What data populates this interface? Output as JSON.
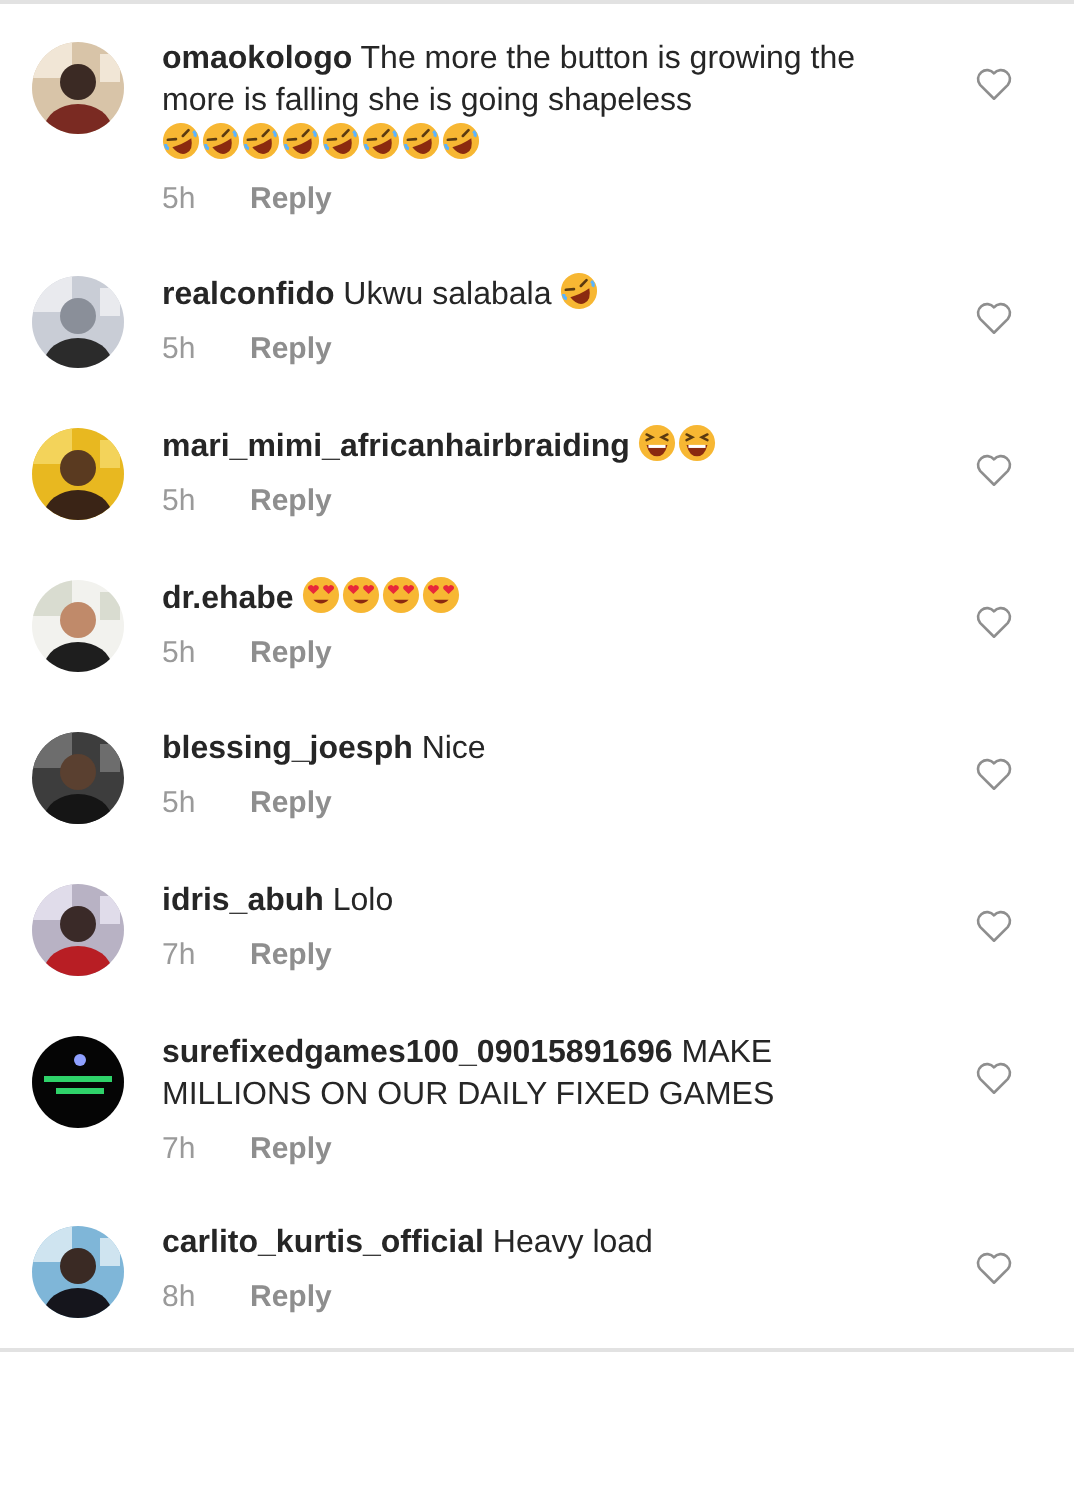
{
  "comments": [
    {
      "avatar": {
        "kind": "picture"
      },
      "username": "omaokologo",
      "text": "The more the button is growing the more is falling she is going shapeless",
      "emojis": [
        {
          "kind": "rofl"
        },
        {
          "kind": "rofl"
        },
        {
          "kind": "rofl"
        },
        {
          "kind": "rofl"
        },
        {
          "kind": "rofl"
        },
        {
          "kind": "rofl"
        },
        {
          "kind": "rofl"
        },
        {
          "kind": "rofl"
        }
      ],
      "time": "5h",
      "reply": "Reply",
      "liked": false
    },
    {
      "avatar": {
        "kind": "picture"
      },
      "username": "realconfido",
      "text": "Ukwu salabala",
      "emojis": [
        {
          "kind": "rofl"
        }
      ],
      "time": "5h",
      "reply": "Reply",
      "liked": false
    },
    {
      "avatar": {
        "kind": "picture"
      },
      "username": "mari_mimi_africanhairbraiding",
      "emojis": [
        {
          "kind": "squint"
        },
        {
          "kind": "squint"
        }
      ],
      "time": "5h",
      "reply": "Reply",
      "liked": false
    },
    {
      "avatar": {
        "kind": "picture"
      },
      "username": "dr.ehabe",
      "emojis": [
        {
          "kind": "hearteyes"
        },
        {
          "kind": "hearteyes"
        },
        {
          "kind": "hearteyes"
        },
        {
          "kind": "hearteyes"
        }
      ],
      "time": "5h",
      "reply": "Reply",
      "liked": false
    },
    {
      "avatar": {
        "kind": "picture"
      },
      "username": "blessing_joesph",
      "text": "Nice",
      "time": "5h",
      "reply": "Reply",
      "liked": false
    },
    {
      "avatar": {
        "kind": "picture"
      },
      "username": "idris_abuh",
      "text": "Lolo",
      "time": "7h",
      "reply": "Reply",
      "liked": false
    },
    {
      "avatar": {
        "kind": "picture"
      },
      "username": "surefixedgames100_09015891696",
      "text": "MAKE MILLIONS ON OUR DAILY FIXED GAMES",
      "time": "7h",
      "reply": "Reply",
      "liked": false
    },
    {
      "avatar": {
        "kind": "picture"
      },
      "username": "carlito_kurtis_official",
      "text": "Heavy load",
      "time": "8h",
      "reply": "Reply",
      "liked": false
    }
  ]
}
